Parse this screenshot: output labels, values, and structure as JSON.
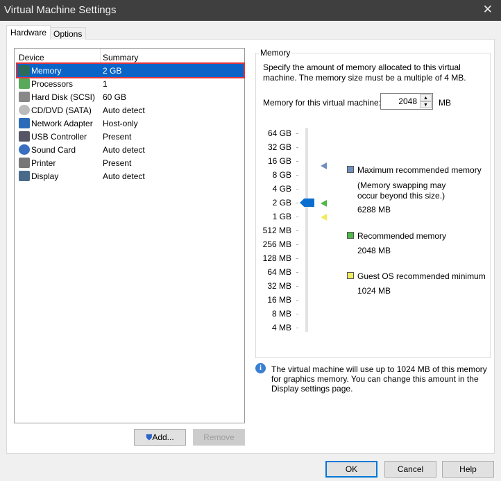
{
  "window": {
    "title": "Virtual Machine Settings",
    "close_icon": "close-icon"
  },
  "tabs": [
    {
      "label": "Hardware",
      "active": true
    },
    {
      "label": "Options",
      "active": false
    }
  ],
  "devices": {
    "headers": {
      "device": "Device",
      "summary": "Summary"
    },
    "rows": [
      {
        "name": "Memory",
        "summary": "2 GB",
        "icon": "memory-icon",
        "selected": true
      },
      {
        "name": "Processors",
        "summary": "1",
        "icon": "processor-icon"
      },
      {
        "name": "Hard Disk (SCSI)",
        "summary": "60 GB",
        "icon": "hard-disk-icon"
      },
      {
        "name": "CD/DVD (SATA)",
        "summary": "Auto detect",
        "icon": "cd-dvd-icon"
      },
      {
        "name": "Network Adapter",
        "summary": "Host-only",
        "icon": "network-adapter-icon"
      },
      {
        "name": "USB Controller",
        "summary": "Present",
        "icon": "usb-icon"
      },
      {
        "name": "Sound Card",
        "summary": "Auto detect",
        "icon": "sound-icon"
      },
      {
        "name": "Printer",
        "summary": "Present",
        "icon": "printer-icon"
      },
      {
        "name": "Display",
        "summary": "Auto detect",
        "icon": "display-icon"
      }
    ],
    "add_label": "Add...",
    "remove_label": "Remove"
  },
  "memory": {
    "group_title": "Memory",
    "desc1": "Specify the amount of memory allocated to this virtual",
    "desc2": "machine. The memory size must be a multiple of 4 MB.",
    "field_label": "Memory for this virtual machine:",
    "value": "2048",
    "unit": "MB",
    "slider_ticks": [
      "64 GB",
      "32 GB",
      "16 GB",
      "8 GB",
      "4 GB",
      "2 GB",
      "1 GB",
      "512 MB",
      "256 MB",
      "128 MB",
      "64 MB",
      "32 MB",
      "16 MB",
      "8 MB",
      "4 MB"
    ],
    "slider_selected": "2 GB",
    "legend": {
      "max_label": "Maximum recommended memory",
      "max_note1": "(Memory swapping may",
      "max_note2": "occur beyond this size.)",
      "max_value": "6288 MB",
      "max_color": "#6f8fc0",
      "rec_label": "Recommended memory",
      "rec_value": "2048 MB",
      "rec_color": "#4fb848",
      "min_label": "Guest OS recommended minimum",
      "min_value": "1024 MB",
      "min_color": "#f0ec60"
    },
    "info1": "The virtual machine will use up to 1024 MB of this memory",
    "info2": "for graphics memory. You can change this amount in the",
    "info3": "Display settings page."
  },
  "footer": {
    "ok": "OK",
    "cancel": "Cancel",
    "help": "Help"
  }
}
